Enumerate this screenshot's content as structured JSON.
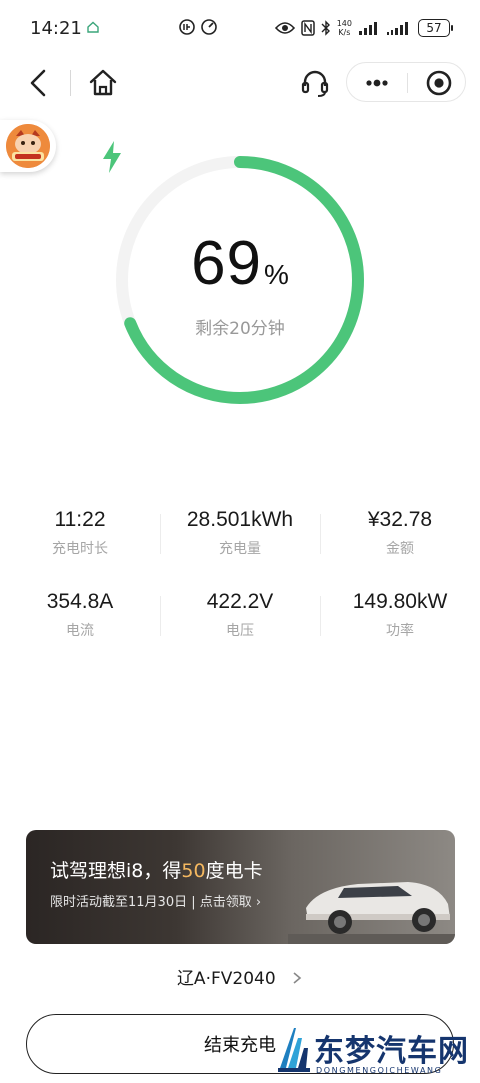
{
  "status_bar": {
    "time": "14:21",
    "net_speed_value": "140",
    "net_speed_unit": "K/s",
    "battery_level": "57"
  },
  "nav": {
    "back_icon": "chevron-left-icon",
    "home_icon": "home-icon",
    "service_icon": "headset-icon",
    "more_icon": "more-dots-icon",
    "close_icon": "target-icon"
  },
  "charging": {
    "percent": "69",
    "percent_unit": "%",
    "percent_fraction": 0.69,
    "remaining": "剩余20分钟",
    "accent_color": "#4cc57a",
    "track_color": "#f3f3f3"
  },
  "stats": [
    {
      "value": "11:22",
      "label": "充电时长"
    },
    {
      "value": "28.501kWh",
      "label": "充电量"
    },
    {
      "value": "¥32.78",
      "label": "金额"
    },
    {
      "value": "354.8A",
      "label": "电流"
    },
    {
      "value": "422.2V",
      "label": "电压"
    },
    {
      "value": "149.80kW",
      "label": "功率"
    }
  ],
  "banner": {
    "title_prefix": "试驾理想i8，得",
    "title_highlight": "50",
    "title_suffix": "度电卡",
    "subtitle": "限时活动截至11月30日 | 点击领取 ›",
    "highlight_color": "#f4b860"
  },
  "plate": {
    "number": "辽A·FV2040"
  },
  "actions": {
    "end_charge_label": "结束充电"
  },
  "watermark": {
    "brand": "东梦汽车网",
    "domain": "DONGMENGQICHEWANG"
  }
}
